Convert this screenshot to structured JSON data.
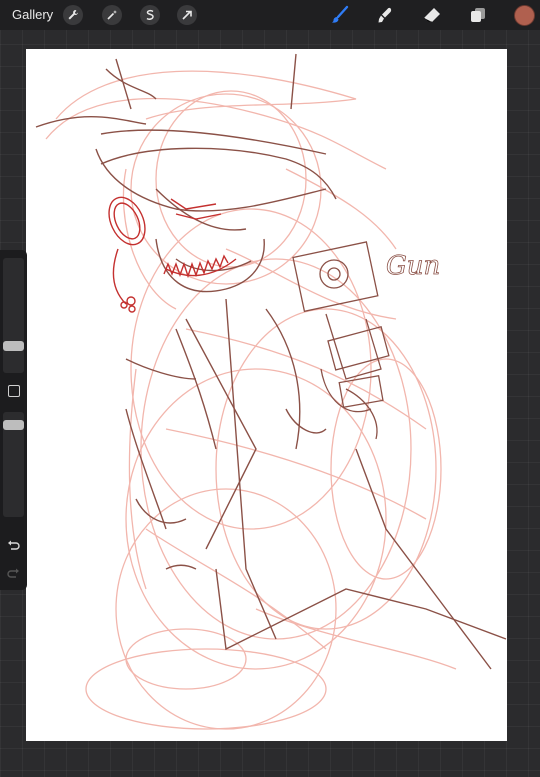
{
  "toolbar": {
    "gallery_label": "Gallery",
    "left_tools": [
      "wrench-icon",
      "magic-wand-icon",
      "selection-icon",
      "transform-arrow-icon"
    ],
    "right_tools": [
      "brush-icon",
      "smudge-icon",
      "eraser-icon",
      "layers-icon"
    ],
    "active_tool": "brush-icon",
    "accent_color": "#2f7cf6",
    "current_color": "#b0604f"
  },
  "sidebar": {
    "brush_size_level": 0.7,
    "opacity_level": 0.4
  },
  "canvas": {
    "background": "#ffffff",
    "sketch_text": "Gun",
    "sketch_colors": {
      "lines": "#8b5147",
      "rough": "#f2b6ad",
      "accent": "#c4302f"
    }
  }
}
